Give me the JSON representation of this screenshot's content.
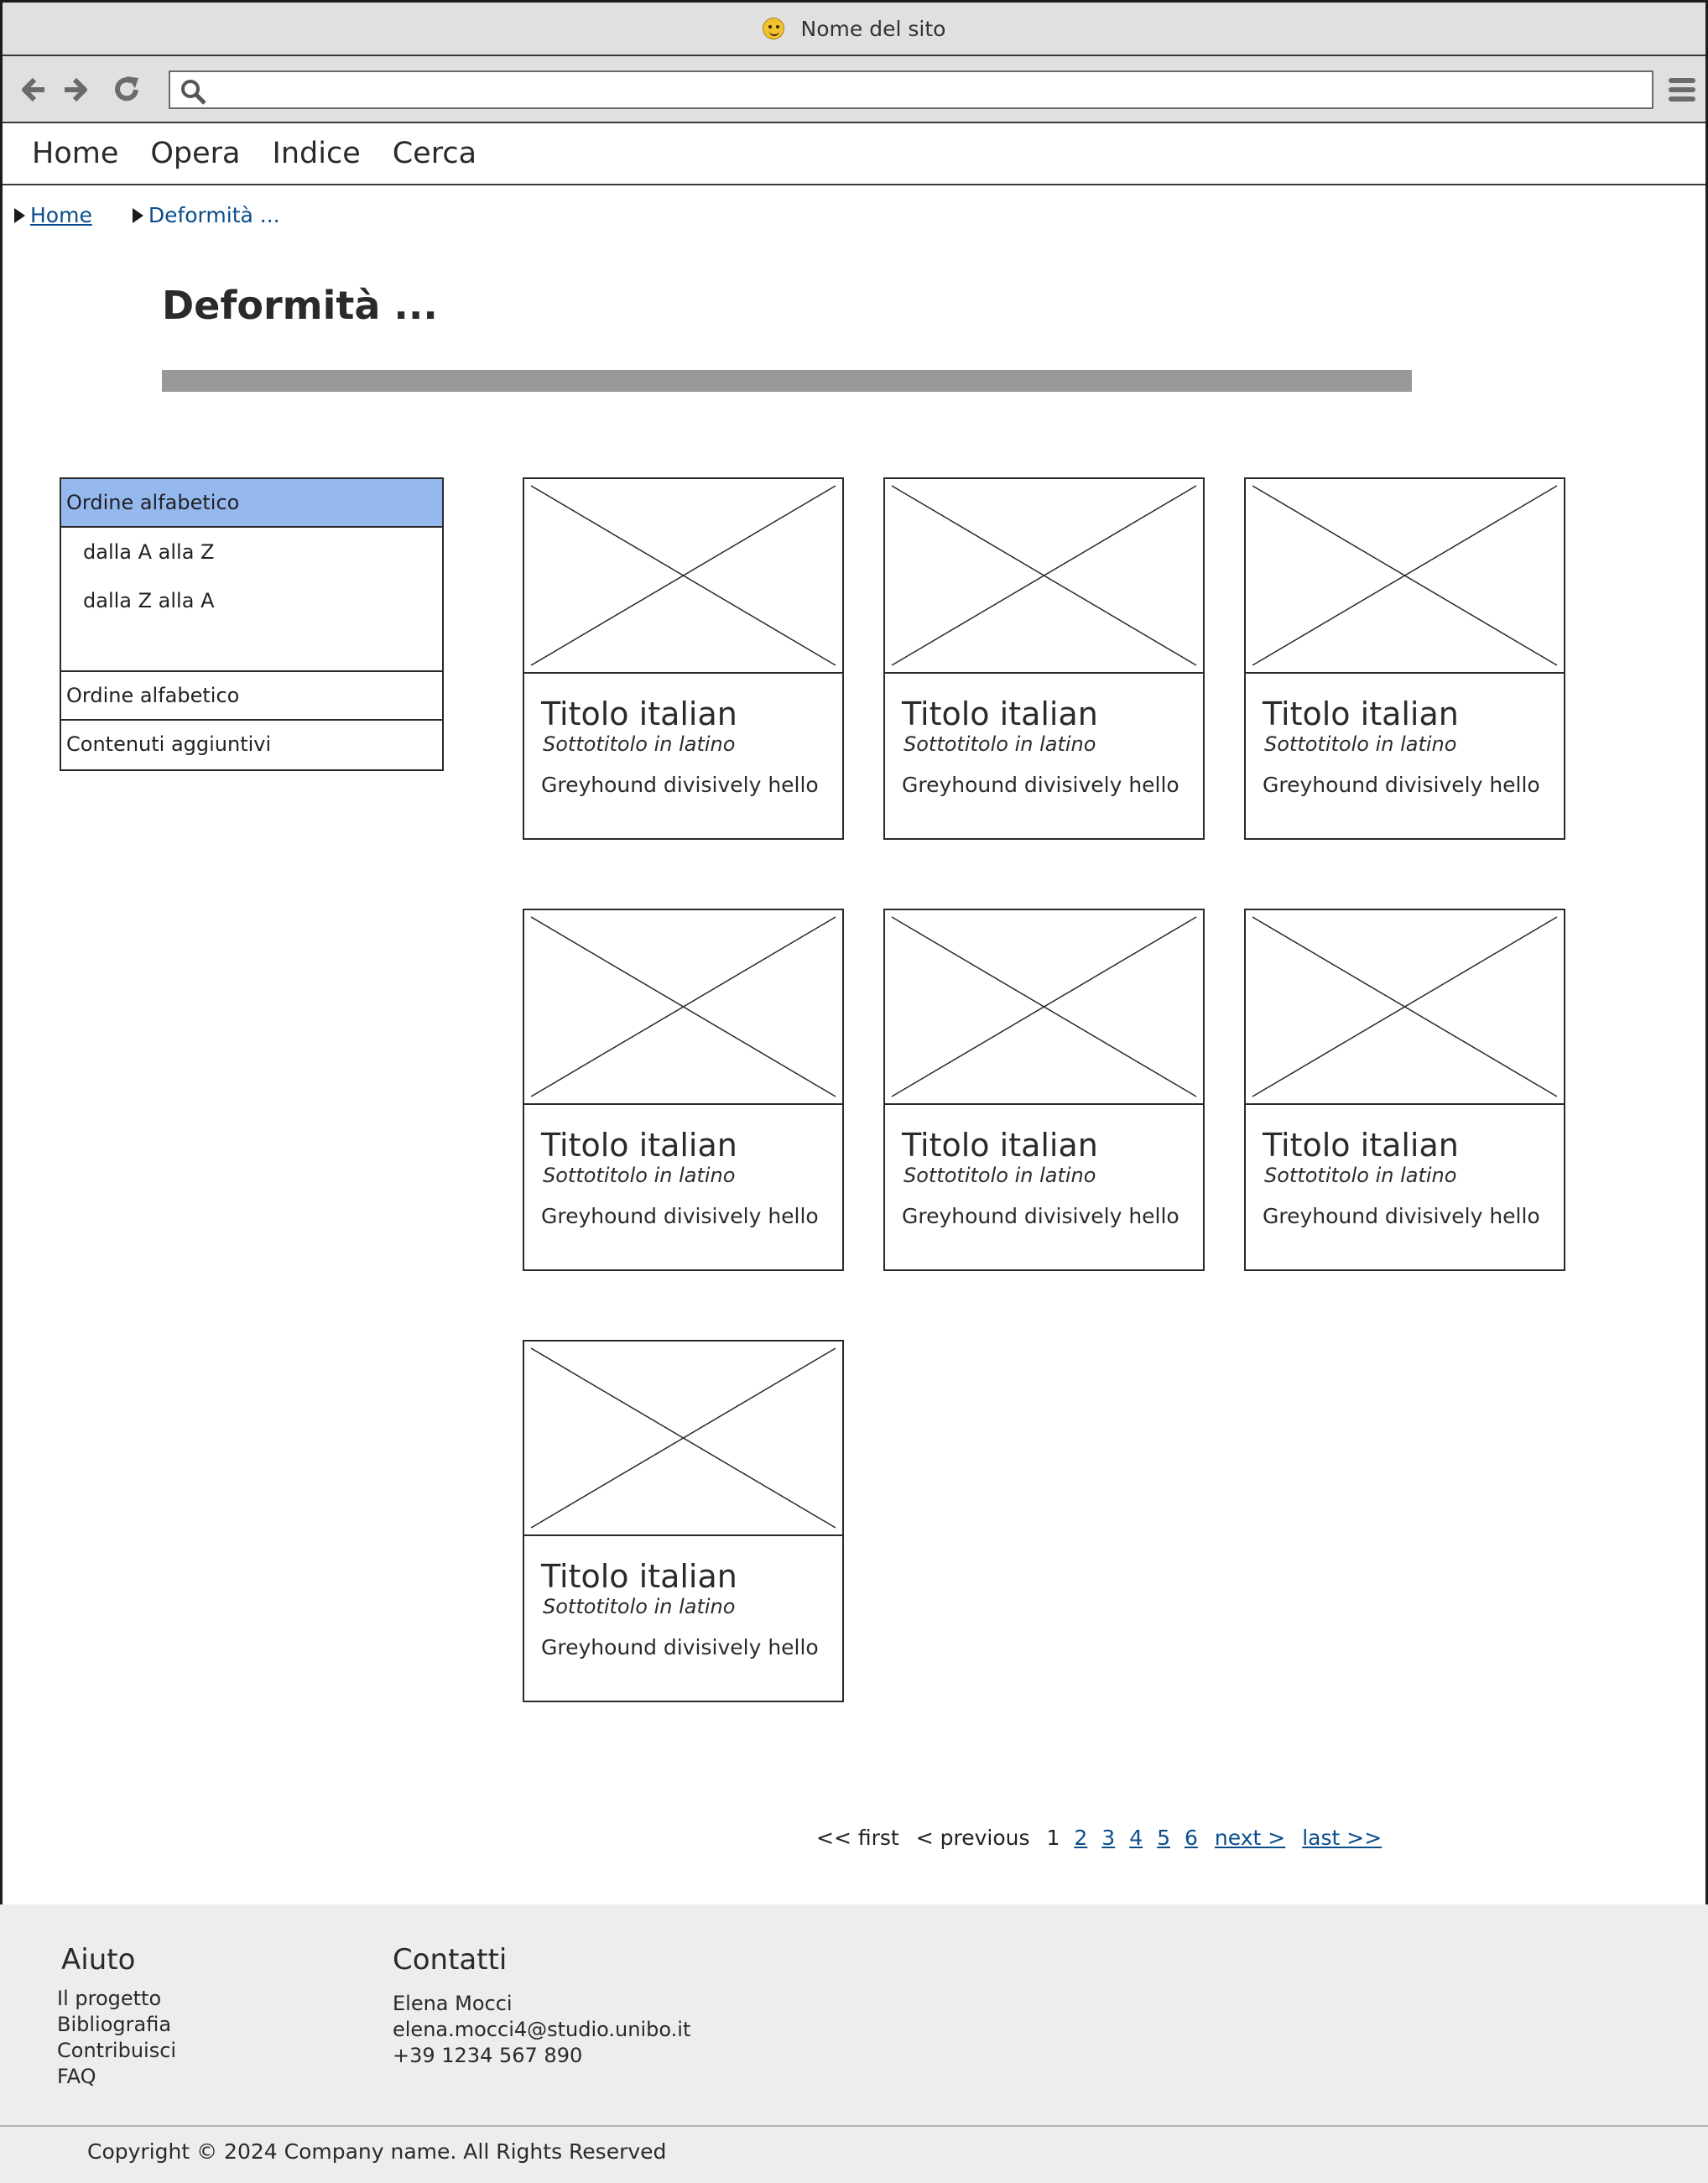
{
  "window": {
    "title": "Nome del sito",
    "icon": "smiley-icon"
  },
  "toolbar": {
    "back_icon": "arrow-left-icon",
    "forward_icon": "arrow-right-icon",
    "reload_icon": "reload-icon",
    "search_icon": "search-icon",
    "address_value": "",
    "menu_icon": "hamburger-menu-icon"
  },
  "nav": {
    "items": [
      "Home",
      "Opera",
      "Indice",
      "Cerca"
    ]
  },
  "breadcrumb": {
    "home": "Home",
    "current": "Deformità ..."
  },
  "page": {
    "title": "Deformità ..."
  },
  "sidebar": {
    "header_active": "Ordine alfabetico",
    "options": [
      "dalla A alla Z",
      "dalla Z alla A"
    ],
    "header_2": "Ordine alfabetico",
    "header_3": "Contenuti aggiuntivi"
  },
  "cards": [
    {
      "title": "Titolo italian",
      "subtitle": "Sottotitolo in latino",
      "text": "Greyhound divisively hello"
    },
    {
      "title": "Titolo italian",
      "subtitle": "Sottotitolo in latino",
      "text": "Greyhound divisively hello"
    },
    {
      "title": "Titolo italian",
      "subtitle": "Sottotitolo in latino",
      "text": "Greyhound divisively hello"
    },
    {
      "title": "Titolo italian",
      "subtitle": "Sottotitolo in latino",
      "text": "Greyhound divisively hello"
    },
    {
      "title": "Titolo italian",
      "subtitle": "Sottotitolo in latino",
      "text": "Greyhound divisively hello"
    },
    {
      "title": "Titolo italian",
      "subtitle": "Sottotitolo in latino",
      "text": "Greyhound divisively hello"
    },
    {
      "title": "Titolo italian",
      "subtitle": "Sottotitolo in latino",
      "text": "Greyhound divisively hello"
    }
  ],
  "pagination": {
    "first": "<< first",
    "previous": "< previous",
    "current": "1",
    "pages": [
      "2",
      "3",
      "4",
      "5",
      "6"
    ],
    "next": "next >",
    "last": "last >>"
  },
  "footer": {
    "help": {
      "heading": "Aiuto",
      "links": [
        "Il progetto",
        "Bibliografia",
        "Contribuisci",
        "FAQ"
      ]
    },
    "contacts": {
      "heading": "Contatti",
      "name": "Elena Mocci",
      "email": "elena.mocci4@studio.unibo.it",
      "phone": "+39 1234 567 890"
    },
    "copyright": "Copyright © 2024 Company name. All Rights Reserved"
  },
  "colors": {
    "accordion_active": "#95b8ef",
    "link": "#0a4d8c",
    "footer_bg": "#ededed",
    "title_rule": "#999999"
  }
}
